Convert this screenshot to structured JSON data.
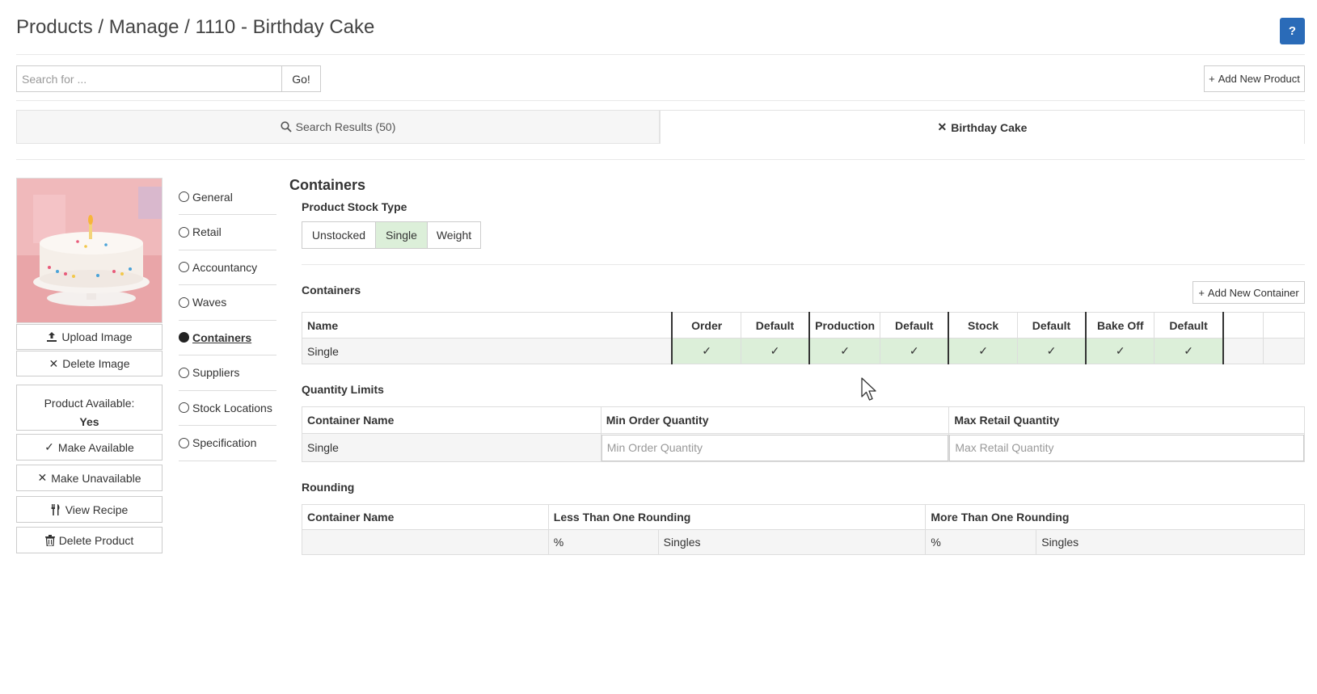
{
  "page": {
    "breadcrumb": "Products / Manage / 1110 - Birthday Cake",
    "help_label": "?"
  },
  "search": {
    "placeholder": "Search for ...",
    "go_label": "Go!",
    "add_product_label": "Add New Product"
  },
  "tabs": {
    "results_label": "Search Results (50)",
    "active_label": "Birthday Cake"
  },
  "sidebar": {
    "upload_image": "Upload Image",
    "delete_image": "Delete Image",
    "availability_label": "Product Available:",
    "availability_value": "Yes",
    "make_available": "Make Available",
    "make_unavailable": "Make Unavailable",
    "view_recipe": "View Recipe",
    "delete_product": "Delete Product"
  },
  "nav": {
    "items": [
      {
        "label": "General",
        "active": false
      },
      {
        "label": "Retail",
        "active": false
      },
      {
        "label": "Accountancy",
        "active": false
      },
      {
        "label": "Waves",
        "active": false
      },
      {
        "label": "Containers",
        "active": true
      },
      {
        "label": "Suppliers",
        "active": false
      },
      {
        "label": "Stock Locations",
        "active": false
      },
      {
        "label": "Specification",
        "active": false
      }
    ]
  },
  "main": {
    "heading": "Containers",
    "stock_type_label": "Product Stock Type",
    "stock_types": [
      "Unstocked",
      "Single",
      "Weight"
    ],
    "stock_type_selected": "Single",
    "containers_label": "Containers",
    "add_container_label": "Add New Container",
    "containers_table": {
      "headers": [
        "Name",
        "Order",
        "Default",
        "Production",
        "Default",
        "Stock",
        "Default",
        "Bake Off",
        "Default",
        "",
        ""
      ],
      "row": {
        "name": "Single",
        "check": "✓"
      }
    },
    "quantity_limits_label": "Quantity Limits",
    "quantity_table": {
      "headers": [
        "Container Name",
        "Min Order Quantity",
        "Max Retail Quantity"
      ],
      "row_name": "Single",
      "min_placeholder": "Min Order Quantity",
      "max_placeholder": "Max Retail Quantity"
    },
    "rounding_label": "Rounding",
    "rounding_table": {
      "headers": [
        "Container Name",
        "Less Than One Rounding",
        "More Than One Rounding"
      ],
      "pct": "%",
      "singles": "Singles"
    }
  },
  "colors": {
    "help_bg": "#2a6bb8",
    "selected_green": "#dcefd9"
  }
}
